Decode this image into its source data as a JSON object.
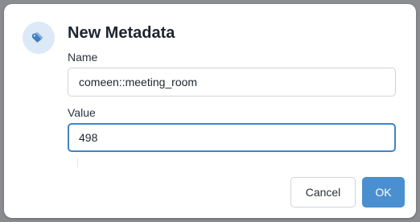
{
  "dialog": {
    "title": "New Metadata",
    "icon": "tag-icon",
    "accent_color": "#4a90d0",
    "fields": {
      "name": {
        "label": "Name",
        "value": "comeen::meeting_room"
      },
      "value": {
        "label": "Value",
        "value": "498"
      }
    },
    "buttons": {
      "cancel_label": "Cancel",
      "ok_label": "OK"
    }
  }
}
